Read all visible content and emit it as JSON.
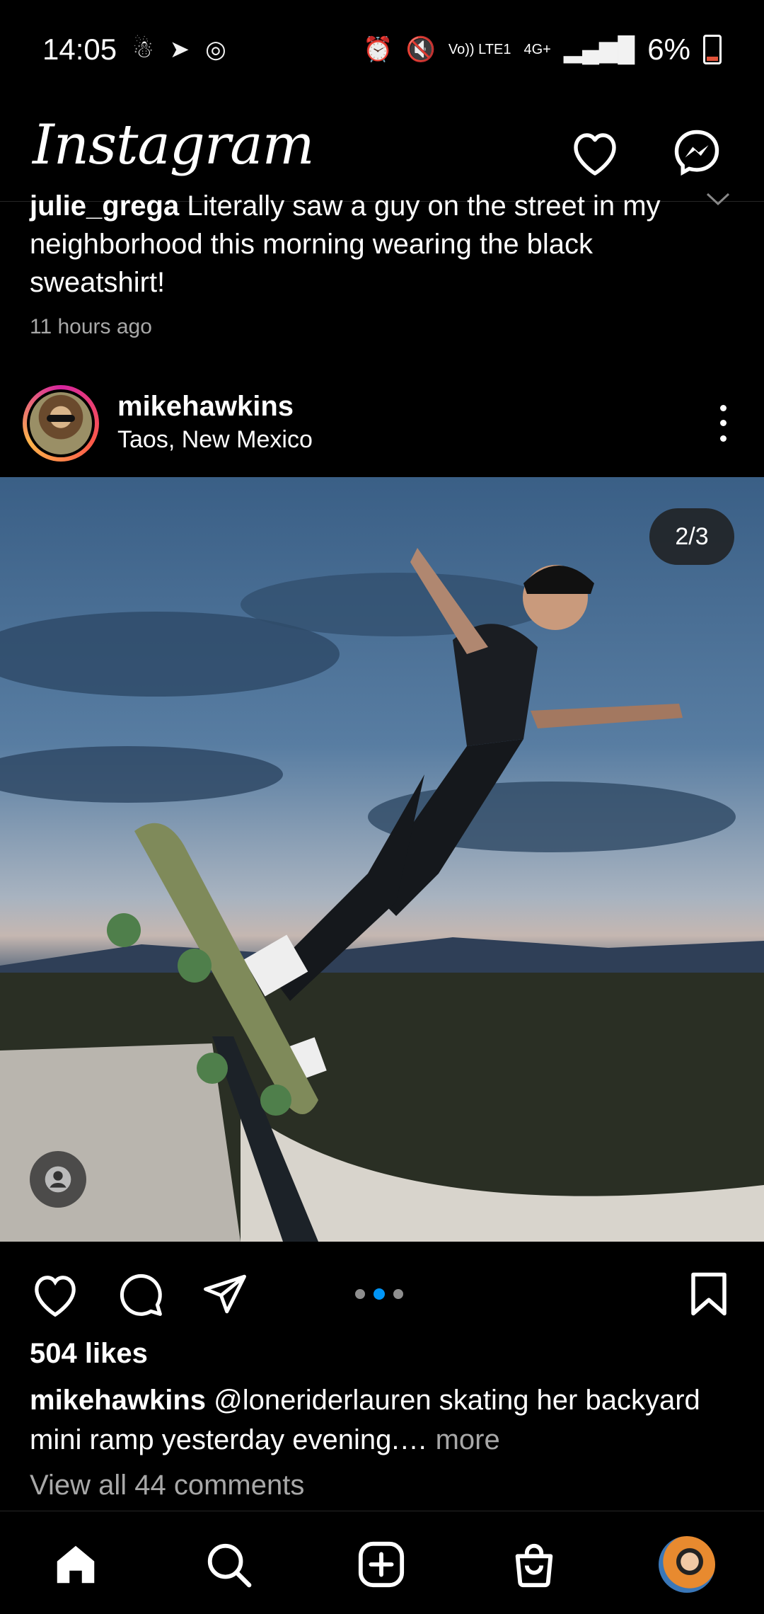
{
  "status_bar": {
    "time": "14:05",
    "network": "Vo)) LTE1",
    "signal_label": "4G+",
    "battery": "6%"
  },
  "header": {
    "app_name": "Instagram"
  },
  "previous_comment": {
    "username": "julie_grega",
    "text": "Literally saw a guy on the street in my neighborhood this morning wearing the black sweatshirt!",
    "time": "11 hours ago"
  },
  "post": {
    "username": "mikehawkins",
    "location": "Taos, New Mexico",
    "image_counter": "2/3",
    "carousel_total": 3,
    "carousel_active": 2,
    "likes": "504 likes",
    "caption_user": "mikehawkins",
    "caption_text": "@loneriderlauren skating her backyard mini ramp yesterday evening.…",
    "caption_more": "more",
    "view_comments": "View all 44 comments"
  },
  "colors": {
    "background": "#000000",
    "accent_blue": "#0095f6",
    "muted_text": "#a8a8a8",
    "battery_low": "#e2533a"
  },
  "icons": {
    "header": [
      "heart-icon",
      "messenger-icon"
    ],
    "actions": [
      "heart-icon",
      "comment-icon",
      "share-icon",
      "bookmark-icon"
    ],
    "nav": [
      "home-icon",
      "search-icon",
      "create-icon",
      "shop-icon",
      "profile-avatar"
    ]
  }
}
